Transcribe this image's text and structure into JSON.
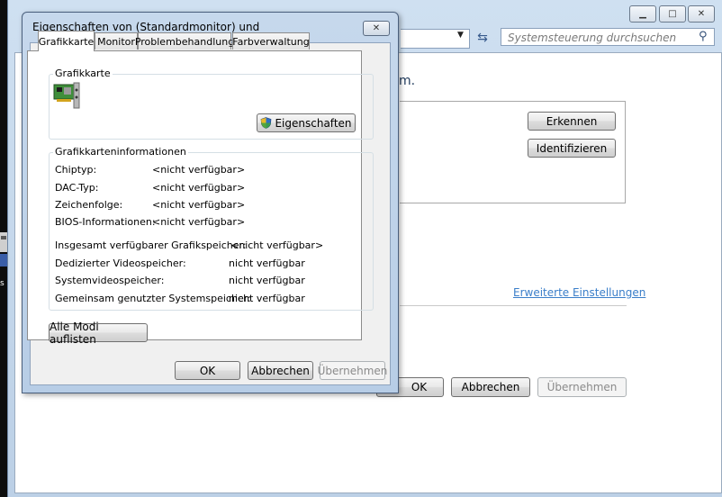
{
  "background_window": {
    "search_placeholder": "Systemsteuerung durchsuchen",
    "heading_fragment": "m.",
    "buttons": {
      "detect": "Erkennen",
      "identify": "Identifizieren",
      "ok": "OK",
      "cancel": "Abbrechen",
      "apply": "Übernehmen"
    },
    "advanced_link": "Erweiterte Einstellungen"
  },
  "dialog": {
    "title": "Eigenschaften von (Standardmonitor) und",
    "tabs": [
      "Grafikkarte",
      "Monitor",
      "Problembehandlung",
      "Farbverwaltung"
    ],
    "active_tab": "Grafikkarte",
    "adapter_group": {
      "label": "Grafikkarte",
      "properties_button": "Eigenschaften"
    },
    "info_group": {
      "label": "Grafikkarteninformationen",
      "rows": [
        {
          "label": "Chiptyp:",
          "value": "<nicht verfügbar>"
        },
        {
          "label": "DAC-Typ:",
          "value": "<nicht verfügbar>"
        },
        {
          "label": "Zeichenfolge:",
          "value": "<nicht verfügbar>"
        },
        {
          "label": "BIOS-Informationen:",
          "value": "<nicht verfügbar>"
        }
      ],
      "memory_rows": [
        {
          "label": "Insgesamt verfügbarer Grafikspeicher:",
          "value": "<nicht verfügbar>"
        },
        {
          "label": "Dedizierter Videospeicher:",
          "value": "nicht verfügbar"
        },
        {
          "label": "Systemvideospeicher:",
          "value": "nicht verfügbar"
        },
        {
          "label": "Gemeinsam genutzter Systemspeicher:",
          "value": "nicht verfügbar"
        }
      ]
    },
    "list_modes_button": "Alle Modi auflisten",
    "buttons": {
      "ok": "OK",
      "cancel": "Abbrechen",
      "apply": "Übernehmen"
    }
  },
  "desktop_fragment_text": "s"
}
